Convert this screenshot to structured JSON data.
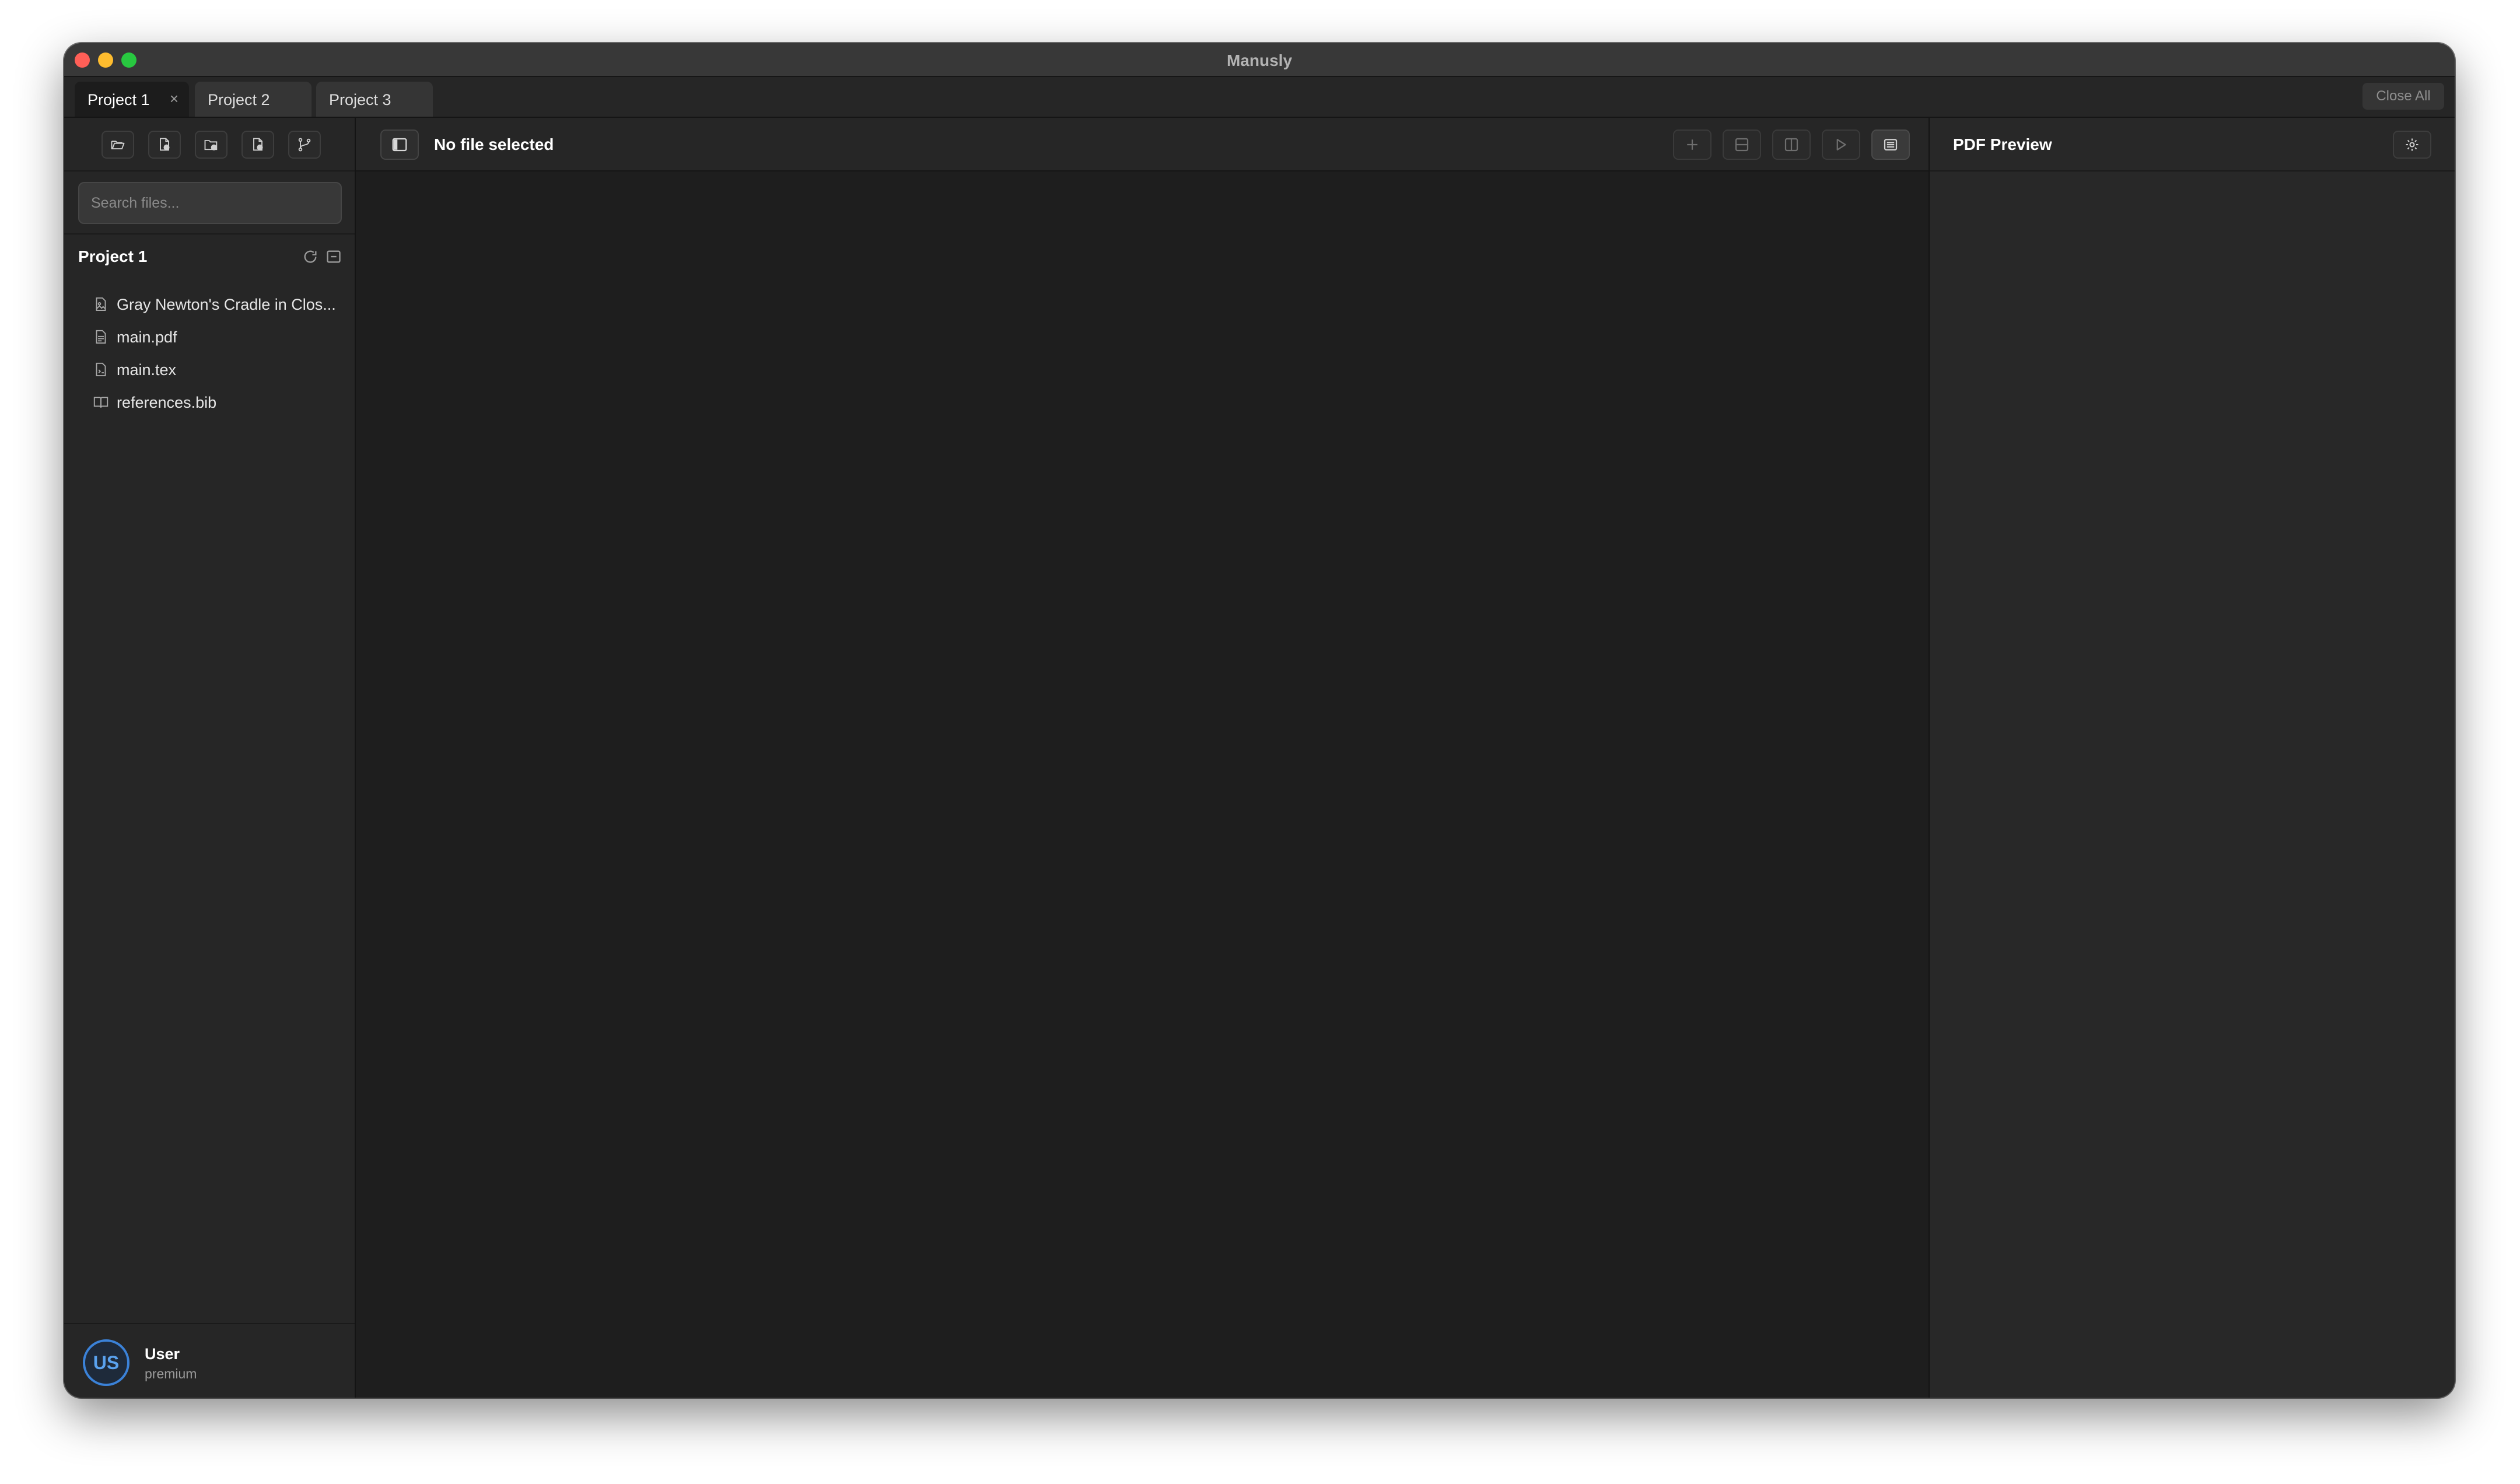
{
  "window": {
    "title": "Manusly"
  },
  "tabs": [
    {
      "label": "Project 1",
      "active": true,
      "close_glyph": "×"
    },
    {
      "label": "Project 2",
      "active": false
    },
    {
      "label": "Project 3",
      "active": false
    }
  ],
  "tabbar": {
    "close_all_label": "Close All"
  },
  "sidebar": {
    "toolbar_icons": [
      "open-folder-icon",
      "new-file-icon",
      "new-folder-icon",
      "add-file-icon",
      "git-branch-icon"
    ],
    "search": {
      "placeholder": "Search files...",
      "value": ""
    },
    "project": {
      "title": "Project 1",
      "icons": [
        "refresh-icon",
        "collapse-icon"
      ]
    },
    "files": [
      {
        "name": "Gray Newton's Cradle in Clos...",
        "icon": "image-file-icon"
      },
      {
        "name": "main.pdf",
        "icon": "pdf-file-icon"
      },
      {
        "name": "main.tex",
        "icon": "tex-file-icon"
      },
      {
        "name": "references.bib",
        "icon": "book-file-icon"
      }
    ],
    "user": {
      "initials": "US",
      "name": "User",
      "plan": "premium"
    }
  },
  "editor": {
    "title": "No file selected",
    "toolbar_icons": [
      "toggle-sidebar-icon",
      "add-icon",
      "split-horizontal-icon",
      "split-vertical-icon",
      "run-icon",
      "terminal-icon"
    ]
  },
  "pdf_panel": {
    "title": "PDF Preview",
    "settings_icon": "settings-icon"
  },
  "colors": {
    "accent": "#3b82d8",
    "window_bg": "#1e1e1e",
    "panel_bg": "#262626",
    "traffic_close": "#ff5f57",
    "traffic_min": "#febc2e",
    "traffic_max": "#28c840"
  }
}
